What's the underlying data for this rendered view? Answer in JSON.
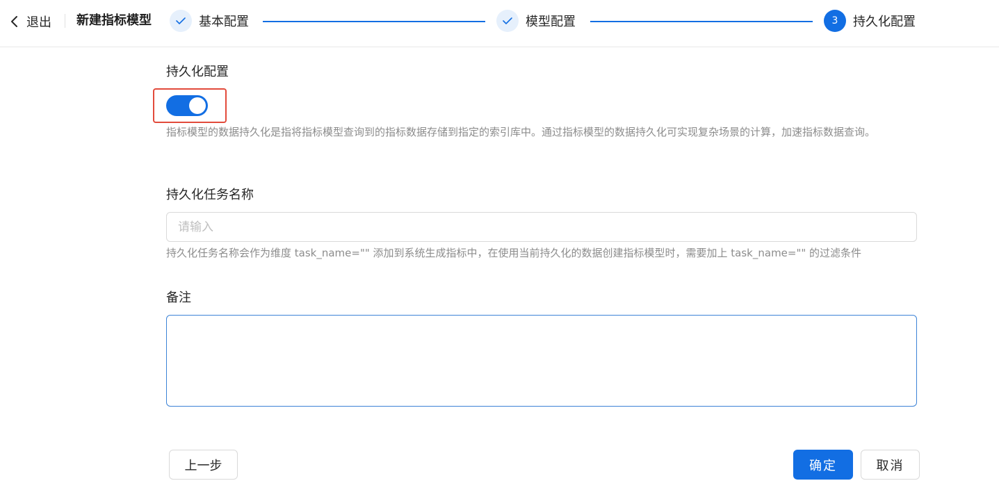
{
  "header": {
    "back_label": "退出",
    "title": "新建指标模型"
  },
  "steps": [
    {
      "label": "基本配置",
      "status": "done"
    },
    {
      "label": "模型配置",
      "status": "done"
    },
    {
      "label": "持久化配置",
      "status": "active",
      "number": "3"
    }
  ],
  "form": {
    "persist": {
      "label": "持久化配置",
      "enabled": true,
      "help": "指标模型的数据持久化是指将指标模型查询到的指标数据存储到指定的索引库中。通过指标模型的数据持久化可实现复杂场景的计算，加速指标数据查询。"
    },
    "task_name": {
      "label": "持久化任务名称",
      "placeholder": "请输入",
      "value": "",
      "help": "持久化任务名称会作为维度 task_name=\"\" 添加到系统生成指标中，在使用当前持久化的数据创建指标模型时，需要加上 task_name=\"\" 的过滤条件"
    },
    "remark": {
      "label": "备注",
      "value": ""
    }
  },
  "footer": {
    "prev_label": "上一步",
    "confirm_label": "确定",
    "cancel_label": "取消"
  },
  "colors": {
    "primary": "#126ee3",
    "highlight_border": "#e24a3b"
  }
}
